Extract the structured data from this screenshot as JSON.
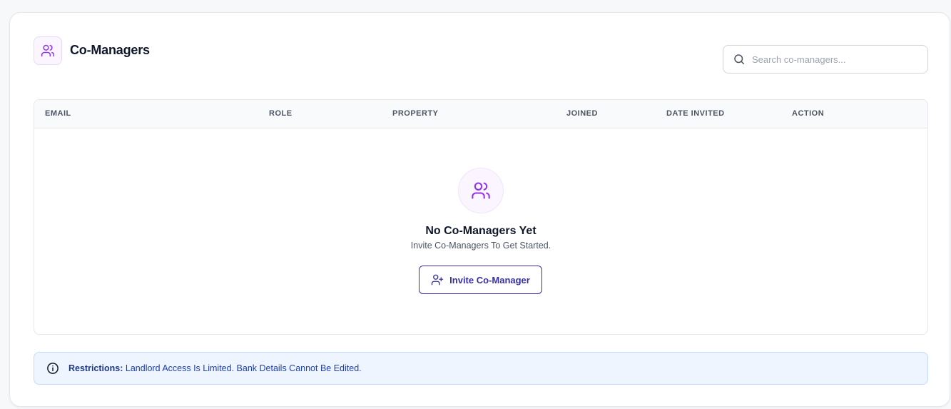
{
  "header": {
    "title": "Co-Managers",
    "icon": "users-icon",
    "accent_color": "#9333ea"
  },
  "search": {
    "placeholder": "Search co-managers...",
    "value": "",
    "icon": "search-icon"
  },
  "table": {
    "columns": [
      "EMAIL",
      "ROLE",
      "PROPERTY",
      "JOINED",
      "DATE INVITED",
      "ACTION"
    ],
    "rows": []
  },
  "empty_state": {
    "icon": "users-icon",
    "title": "No Co-Managers Yet",
    "subtitle": "Invite Co-Managers To Get Started.",
    "button_label": "Invite Co-Manager",
    "button_icon": "user-plus-icon",
    "button_color": "#3730a3"
  },
  "notice": {
    "icon": "info-icon",
    "label": "Restrictions:",
    "text": "Landlord Access Is Limited. Bank Details Cannot Be Edited.",
    "text_color": "#1e40af",
    "background": "#eef5ff"
  }
}
